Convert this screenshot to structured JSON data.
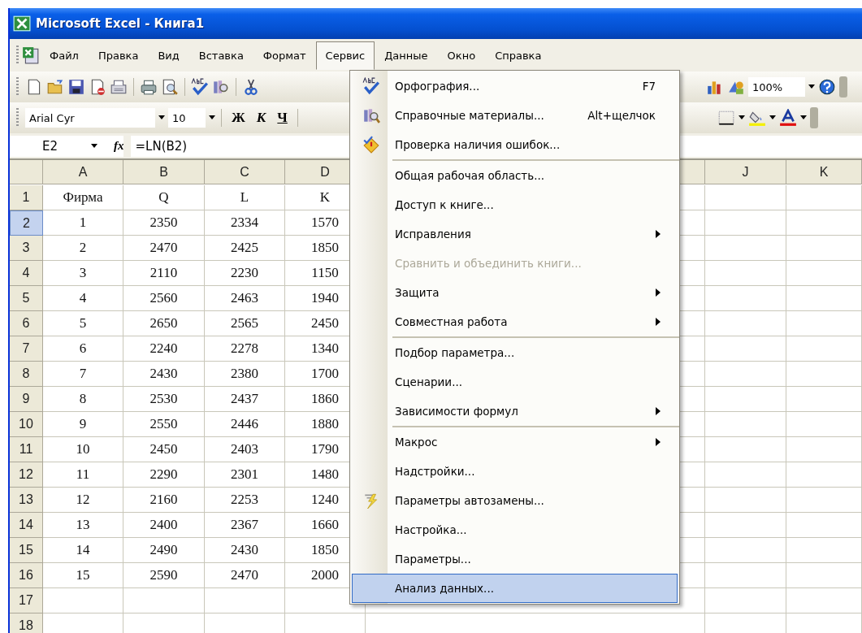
{
  "window": {
    "title": "Microsoft Excel - Книга1"
  },
  "menu_bar": [
    {
      "label": "Файл",
      "selected": false
    },
    {
      "label": "Правка",
      "selected": false
    },
    {
      "label": "Вид",
      "selected": false
    },
    {
      "label": "Вставка",
      "selected": false
    },
    {
      "label": "Формат",
      "selected": false
    },
    {
      "label": "Сервис",
      "selected": true
    },
    {
      "label": "Данные",
      "selected": false
    },
    {
      "label": "Окно",
      "selected": false
    },
    {
      "label": "Справка",
      "selected": false
    }
  ],
  "standard_toolbar": {
    "zoom": "100%"
  },
  "formatting_toolbar": {
    "font": "Arial Cyr",
    "size": "10",
    "bold": "Ж",
    "italic": "К",
    "underline": "Ч"
  },
  "formula_bar": {
    "name_box": "E2",
    "fx": "fx",
    "formula": "=LN(B2)"
  },
  "columns": [
    "A",
    "B",
    "C",
    "D",
    "J",
    "K"
  ],
  "rows": [
    {
      "header": "1",
      "selected": false,
      "cells": [
        "Фирма",
        "Q",
        "L",
        "K"
      ]
    },
    {
      "header": "2",
      "selected": true,
      "cells": [
        "1",
        "2350",
        "2334",
        "1570"
      ]
    },
    {
      "header": "3",
      "selected": false,
      "cells": [
        "2",
        "2470",
        "2425",
        "1850"
      ]
    },
    {
      "header": "4",
      "selected": false,
      "cells": [
        "3",
        "2110",
        "2230",
        "1150"
      ]
    },
    {
      "header": "5",
      "selected": false,
      "cells": [
        "4",
        "2560",
        "2463",
        "1940"
      ]
    },
    {
      "header": "6",
      "selected": false,
      "cells": [
        "5",
        "2650",
        "2565",
        "2450"
      ]
    },
    {
      "header": "7",
      "selected": false,
      "cells": [
        "6",
        "2240",
        "2278",
        "1340"
      ]
    },
    {
      "header": "8",
      "selected": false,
      "cells": [
        "7",
        "2430",
        "2380",
        "1700"
      ]
    },
    {
      "header": "9",
      "selected": false,
      "cells": [
        "8",
        "2530",
        "2437",
        "1860"
      ]
    },
    {
      "header": "10",
      "selected": false,
      "cells": [
        "9",
        "2550",
        "2446",
        "1880"
      ]
    },
    {
      "header": "11",
      "selected": false,
      "cells": [
        "10",
        "2450",
        "2403",
        "1790"
      ]
    },
    {
      "header": "12",
      "selected": false,
      "cells": [
        "11",
        "2290",
        "2301",
        "1480"
      ]
    },
    {
      "header": "13",
      "selected": false,
      "cells": [
        "12",
        "2160",
        "2253",
        "1240"
      ]
    },
    {
      "header": "14",
      "selected": false,
      "cells": [
        "13",
        "2400",
        "2367",
        "1660"
      ]
    },
    {
      "header": "15",
      "selected": false,
      "cells": [
        "14",
        "2490",
        "2430",
        "1850"
      ]
    },
    {
      "header": "16",
      "selected": false,
      "cells": [
        "15",
        "2590",
        "2470",
        "2000"
      ]
    },
    {
      "header": "17",
      "selected": false,
      "cells": [
        "",
        "",
        "",
        ""
      ]
    },
    {
      "header": "18",
      "selected": false,
      "cells": [
        "",
        "",
        "",
        ""
      ]
    }
  ],
  "menu": {
    "groups": [
      [
        {
          "label": "Орфография...",
          "shortcut": "F7",
          "icon": true,
          "submenu": false,
          "disabled": false,
          "selected": false
        },
        {
          "label": "Справочные материалы...",
          "shortcut": "Alt+щелчок",
          "icon": true,
          "submenu": false,
          "disabled": false,
          "selected": false
        },
        {
          "label": "Проверка наличия ошибок...",
          "icon": true,
          "submenu": false,
          "disabled": false,
          "selected": false
        }
      ],
      [
        {
          "label": "Общая рабочая область...",
          "icon": false,
          "submenu": false,
          "disabled": false,
          "selected": false
        },
        {
          "label": "Доступ к книге...",
          "icon": false,
          "submenu": false,
          "disabled": false,
          "selected": false
        },
        {
          "label": "Исправления",
          "icon": false,
          "submenu": true,
          "disabled": false,
          "selected": false
        },
        {
          "label": "Сравнить и объединить книги...",
          "icon": false,
          "submenu": false,
          "disabled": true,
          "selected": false
        },
        {
          "label": "Защита",
          "icon": false,
          "submenu": true,
          "disabled": false,
          "selected": false
        },
        {
          "label": "Совместная работа",
          "icon": false,
          "submenu": true,
          "disabled": false,
          "selected": false
        }
      ],
      [
        {
          "label": "Подбор параметра...",
          "icon": false,
          "submenu": false,
          "disabled": false,
          "selected": false
        },
        {
          "label": "Сценарии...",
          "icon": false,
          "submenu": false,
          "disabled": false,
          "selected": false
        },
        {
          "label": "Зависимости формул",
          "icon": false,
          "submenu": true,
          "disabled": false,
          "selected": false
        }
      ],
      [
        {
          "label": "Макрос",
          "icon": false,
          "submenu": true,
          "disabled": false,
          "selected": false
        },
        {
          "label": "Надстройки...",
          "icon": false,
          "submenu": false,
          "disabled": false,
          "selected": false
        },
        {
          "label": "Параметры автозамены...",
          "icon": true,
          "submenu": false,
          "disabled": false,
          "selected": false
        },
        {
          "label": "Настройка...",
          "icon": false,
          "submenu": false,
          "disabled": false,
          "selected": false
        },
        {
          "label": "Параметры...",
          "icon": false,
          "submenu": false,
          "disabled": false,
          "selected": false
        },
        {
          "label": "Анализ данных...",
          "icon": false,
          "submenu": false,
          "disabled": false,
          "selected": true
        }
      ]
    ]
  }
}
